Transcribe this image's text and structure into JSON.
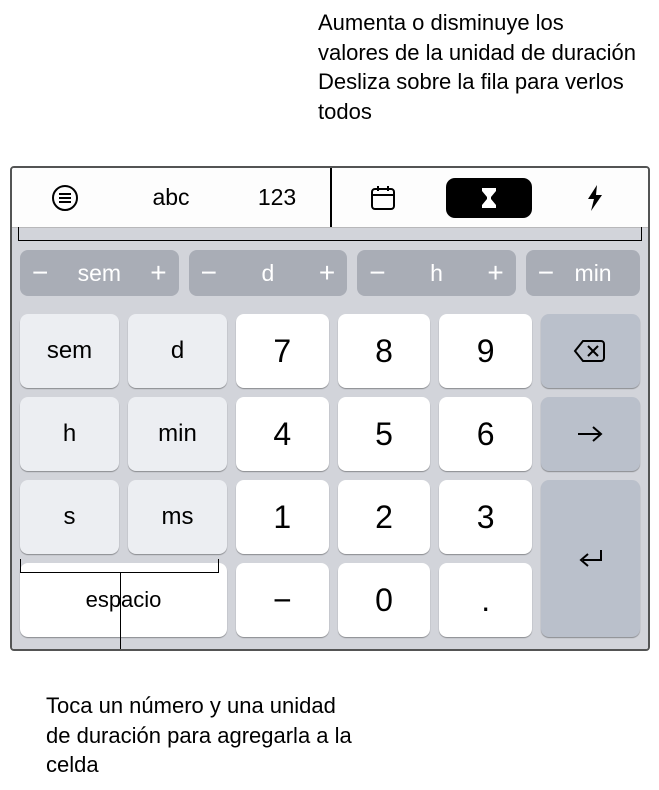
{
  "annotations": {
    "top": "Aumenta o disminuye los valores de la unidad de duración Desliza sobre la fila para verlos todos",
    "bottom": "Toca un número y una unidad de duración para agregarla a la celda"
  },
  "toolbar": {
    "abc": "abc",
    "num": "123"
  },
  "unit_row": {
    "minus": "−",
    "plus": "+",
    "items": [
      "sem",
      "d",
      "h",
      "min"
    ]
  },
  "keys": {
    "units": {
      "sem": "sem",
      "d": "d",
      "h": "h",
      "min": "min",
      "s": "s",
      "ms": "ms"
    },
    "digits": {
      "n0": "0",
      "n1": "1",
      "n2": "2",
      "n3": "3",
      "n4": "4",
      "n5": "5",
      "n6": "6",
      "n7": "7",
      "n8": "8",
      "n9": "9"
    },
    "minus": "−",
    "dot": ".",
    "space": "espacio"
  }
}
